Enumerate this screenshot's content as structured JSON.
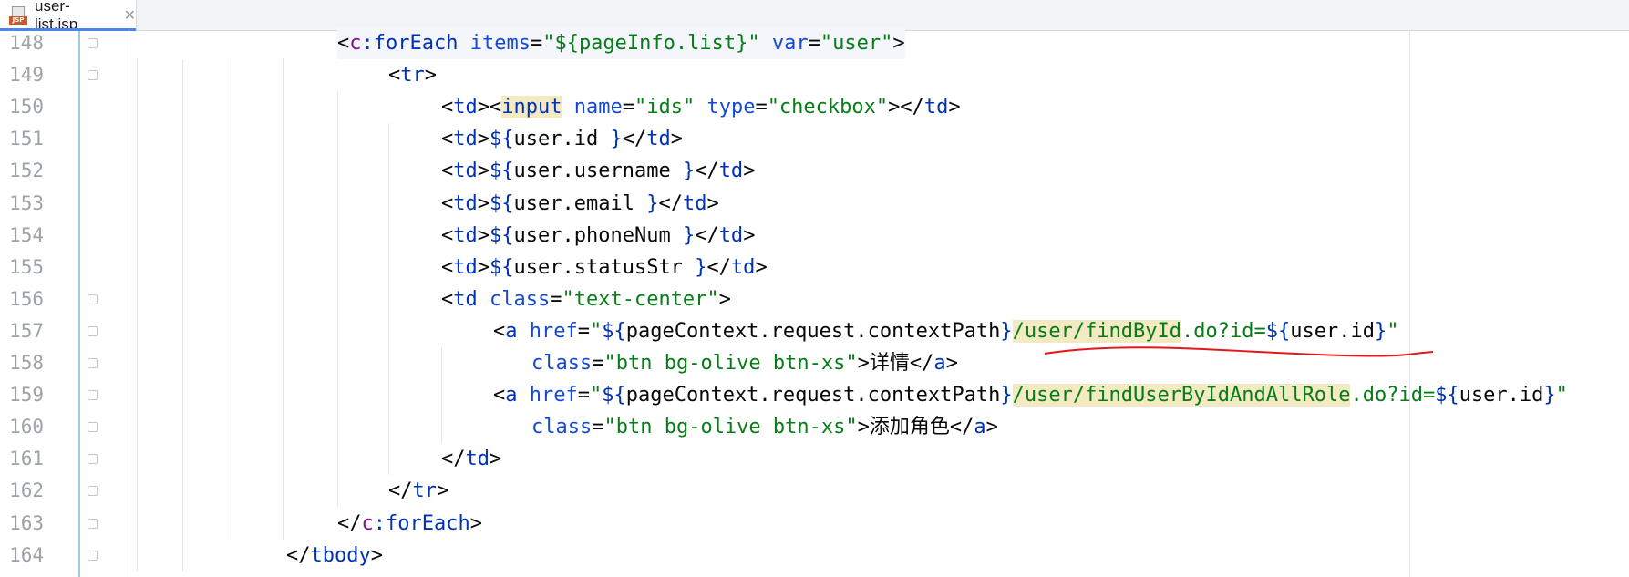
{
  "tab": {
    "file_name": "user-list.jsp",
    "icon": "jsp-file-icon",
    "icon_label": "JSP",
    "close_glyph": "✕"
  },
  "colors": {
    "tag": "#0033b3",
    "namespace": "#871094",
    "attribute": "#174ad4",
    "string": "#067d17",
    "text": "#080808",
    "line_number": "#9ea3aa",
    "match_highlight": "#f3e9c3",
    "annotation": "#e0191b"
  },
  "lines": [
    {
      "number": "148",
      "tokens": [
        [
          "p",
          "<"
        ],
        [
          "ns",
          "c"
        ],
        [
          "tag",
          ":forEach "
        ],
        [
          "attr",
          "items"
        ],
        [
          "p",
          "="
        ],
        [
          "str",
          "\"${pageInfo.list}\""
        ],
        [
          "p",
          " "
        ],
        [
          "attr",
          "var"
        ],
        [
          "p",
          "="
        ],
        [
          "str",
          "\"user\""
        ],
        [
          "p",
          ">"
        ]
      ]
    },
    {
      "number": "149",
      "tokens": [
        [
          "p",
          "<"
        ],
        [
          "tag",
          "tr"
        ],
        [
          "p",
          ">"
        ]
      ]
    },
    {
      "number": "150",
      "tokens": [
        [
          "p",
          "<"
        ],
        [
          "tag",
          "td"
        ],
        [
          "p",
          "><"
        ],
        [
          "tagm",
          "input"
        ],
        [
          "p",
          " "
        ],
        [
          "attr",
          "name"
        ],
        [
          "p",
          "="
        ],
        [
          "str",
          "\"ids\""
        ],
        [
          "p",
          " "
        ],
        [
          "attr",
          "type"
        ],
        [
          "p",
          "="
        ],
        [
          "str",
          "\"checkbox\""
        ],
        [
          "p",
          "></"
        ],
        [
          "tag",
          "td"
        ],
        [
          "p",
          ">"
        ]
      ]
    },
    {
      "number": "151",
      "tokens": [
        [
          "p",
          "<"
        ],
        [
          "tag",
          "td"
        ],
        [
          "p",
          ">"
        ],
        [
          "el",
          "${"
        ],
        [
          "p",
          "user.id "
        ],
        [
          "el",
          "}"
        ],
        [
          "p",
          "</"
        ],
        [
          "tag",
          "td"
        ],
        [
          "p",
          ">"
        ]
      ]
    },
    {
      "number": "152",
      "tokens": [
        [
          "p",
          "<"
        ],
        [
          "tag",
          "td"
        ],
        [
          "p",
          ">"
        ],
        [
          "el",
          "${"
        ],
        [
          "p",
          "user.username "
        ],
        [
          "el",
          "}"
        ],
        [
          "p",
          "</"
        ],
        [
          "tag",
          "td"
        ],
        [
          "p",
          ">"
        ]
      ]
    },
    {
      "number": "153",
      "tokens": [
        [
          "p",
          "<"
        ],
        [
          "tag",
          "td"
        ],
        [
          "p",
          ">"
        ],
        [
          "el",
          "${"
        ],
        [
          "p",
          "user.email "
        ],
        [
          "el",
          "}"
        ],
        [
          "p",
          "</"
        ],
        [
          "tag",
          "td"
        ],
        [
          "p",
          ">"
        ]
      ]
    },
    {
      "number": "154",
      "tokens": [
        [
          "p",
          "<"
        ],
        [
          "tag",
          "td"
        ],
        [
          "p",
          ">"
        ],
        [
          "el",
          "${"
        ],
        [
          "p",
          "user.phoneNum "
        ],
        [
          "el",
          "}"
        ],
        [
          "p",
          "</"
        ],
        [
          "tag",
          "td"
        ],
        [
          "p",
          ">"
        ]
      ]
    },
    {
      "number": "155",
      "tokens": [
        [
          "p",
          "<"
        ],
        [
          "tag",
          "td"
        ],
        [
          "p",
          ">"
        ],
        [
          "el",
          "${"
        ],
        [
          "p",
          "user.statusStr "
        ],
        [
          "el",
          "}"
        ],
        [
          "p",
          "</"
        ],
        [
          "tag",
          "td"
        ],
        [
          "p",
          ">"
        ]
      ]
    },
    {
      "number": "156",
      "tokens": [
        [
          "p",
          "<"
        ],
        [
          "tag",
          "td"
        ],
        [
          "p",
          " "
        ],
        [
          "attr",
          "class"
        ],
        [
          "p",
          "="
        ],
        [
          "str",
          "\"text-center\""
        ],
        [
          "p",
          ">"
        ]
      ]
    },
    {
      "number": "157",
      "tokens": [
        [
          "p",
          "<"
        ],
        [
          "tag",
          "a"
        ],
        [
          "p",
          " "
        ],
        [
          "attr",
          "href"
        ],
        [
          "p",
          "="
        ],
        [
          "str",
          "\""
        ],
        [
          "el",
          "${"
        ],
        [
          "p",
          "pageContext.request.contextPath"
        ],
        [
          "el",
          "}"
        ],
        [
          "strm",
          "/user/findById"
        ],
        [
          "str",
          ".do?id="
        ],
        [
          "el",
          "${"
        ],
        [
          "p",
          "user.id"
        ],
        [
          "el",
          "}"
        ],
        [
          "str",
          "\""
        ]
      ]
    },
    {
      "number": "158",
      "tokens": [
        [
          "attr",
          "class"
        ],
        [
          "p",
          "="
        ],
        [
          "str",
          "\"btn bg-olive btn-xs\""
        ],
        [
          "p",
          ">详情</"
        ],
        [
          "tag",
          "a"
        ],
        [
          "p",
          ">"
        ]
      ]
    },
    {
      "number": "159",
      "tokens": [
        [
          "p",
          "<"
        ],
        [
          "tag",
          "a"
        ],
        [
          "p",
          " "
        ],
        [
          "attr",
          "href"
        ],
        [
          "p",
          "="
        ],
        [
          "str",
          "\""
        ],
        [
          "el",
          "${"
        ],
        [
          "p",
          "pageContext.request.contextPath"
        ],
        [
          "el",
          "}"
        ],
        [
          "strm",
          "/user/findUserByIdAndAllRole"
        ],
        [
          "str",
          ".do?id="
        ],
        [
          "el",
          "${"
        ],
        [
          "p",
          "user.id"
        ],
        [
          "el",
          "}"
        ],
        [
          "str",
          "\""
        ]
      ]
    },
    {
      "number": "160",
      "tokens": [
        [
          "attr",
          "class"
        ],
        [
          "p",
          "="
        ],
        [
          "str",
          "\"btn bg-olive btn-xs\""
        ],
        [
          "p",
          ">添加角色</"
        ],
        [
          "tag",
          "a"
        ],
        [
          "p",
          ">"
        ]
      ]
    },
    {
      "number": "161",
      "tokens": [
        [
          "p",
          "</"
        ],
        [
          "tag",
          "td"
        ],
        [
          "p",
          ">"
        ]
      ]
    },
    {
      "number": "162",
      "tokens": [
        [
          "p",
          "</"
        ],
        [
          "tag",
          "tr"
        ],
        [
          "p",
          ">"
        ]
      ]
    },
    {
      "number": "163",
      "tokens": [
        [
          "p",
          "</"
        ],
        [
          "ns",
          "c"
        ],
        [
          "tag",
          ":forEach"
        ],
        [
          "p",
          ">"
        ]
      ]
    },
    {
      "number": "164",
      "tokens": [
        [
          "p",
          "</"
        ],
        [
          "tag",
          "tbody"
        ],
        [
          "p",
          ">"
        ]
      ]
    }
  ]
}
